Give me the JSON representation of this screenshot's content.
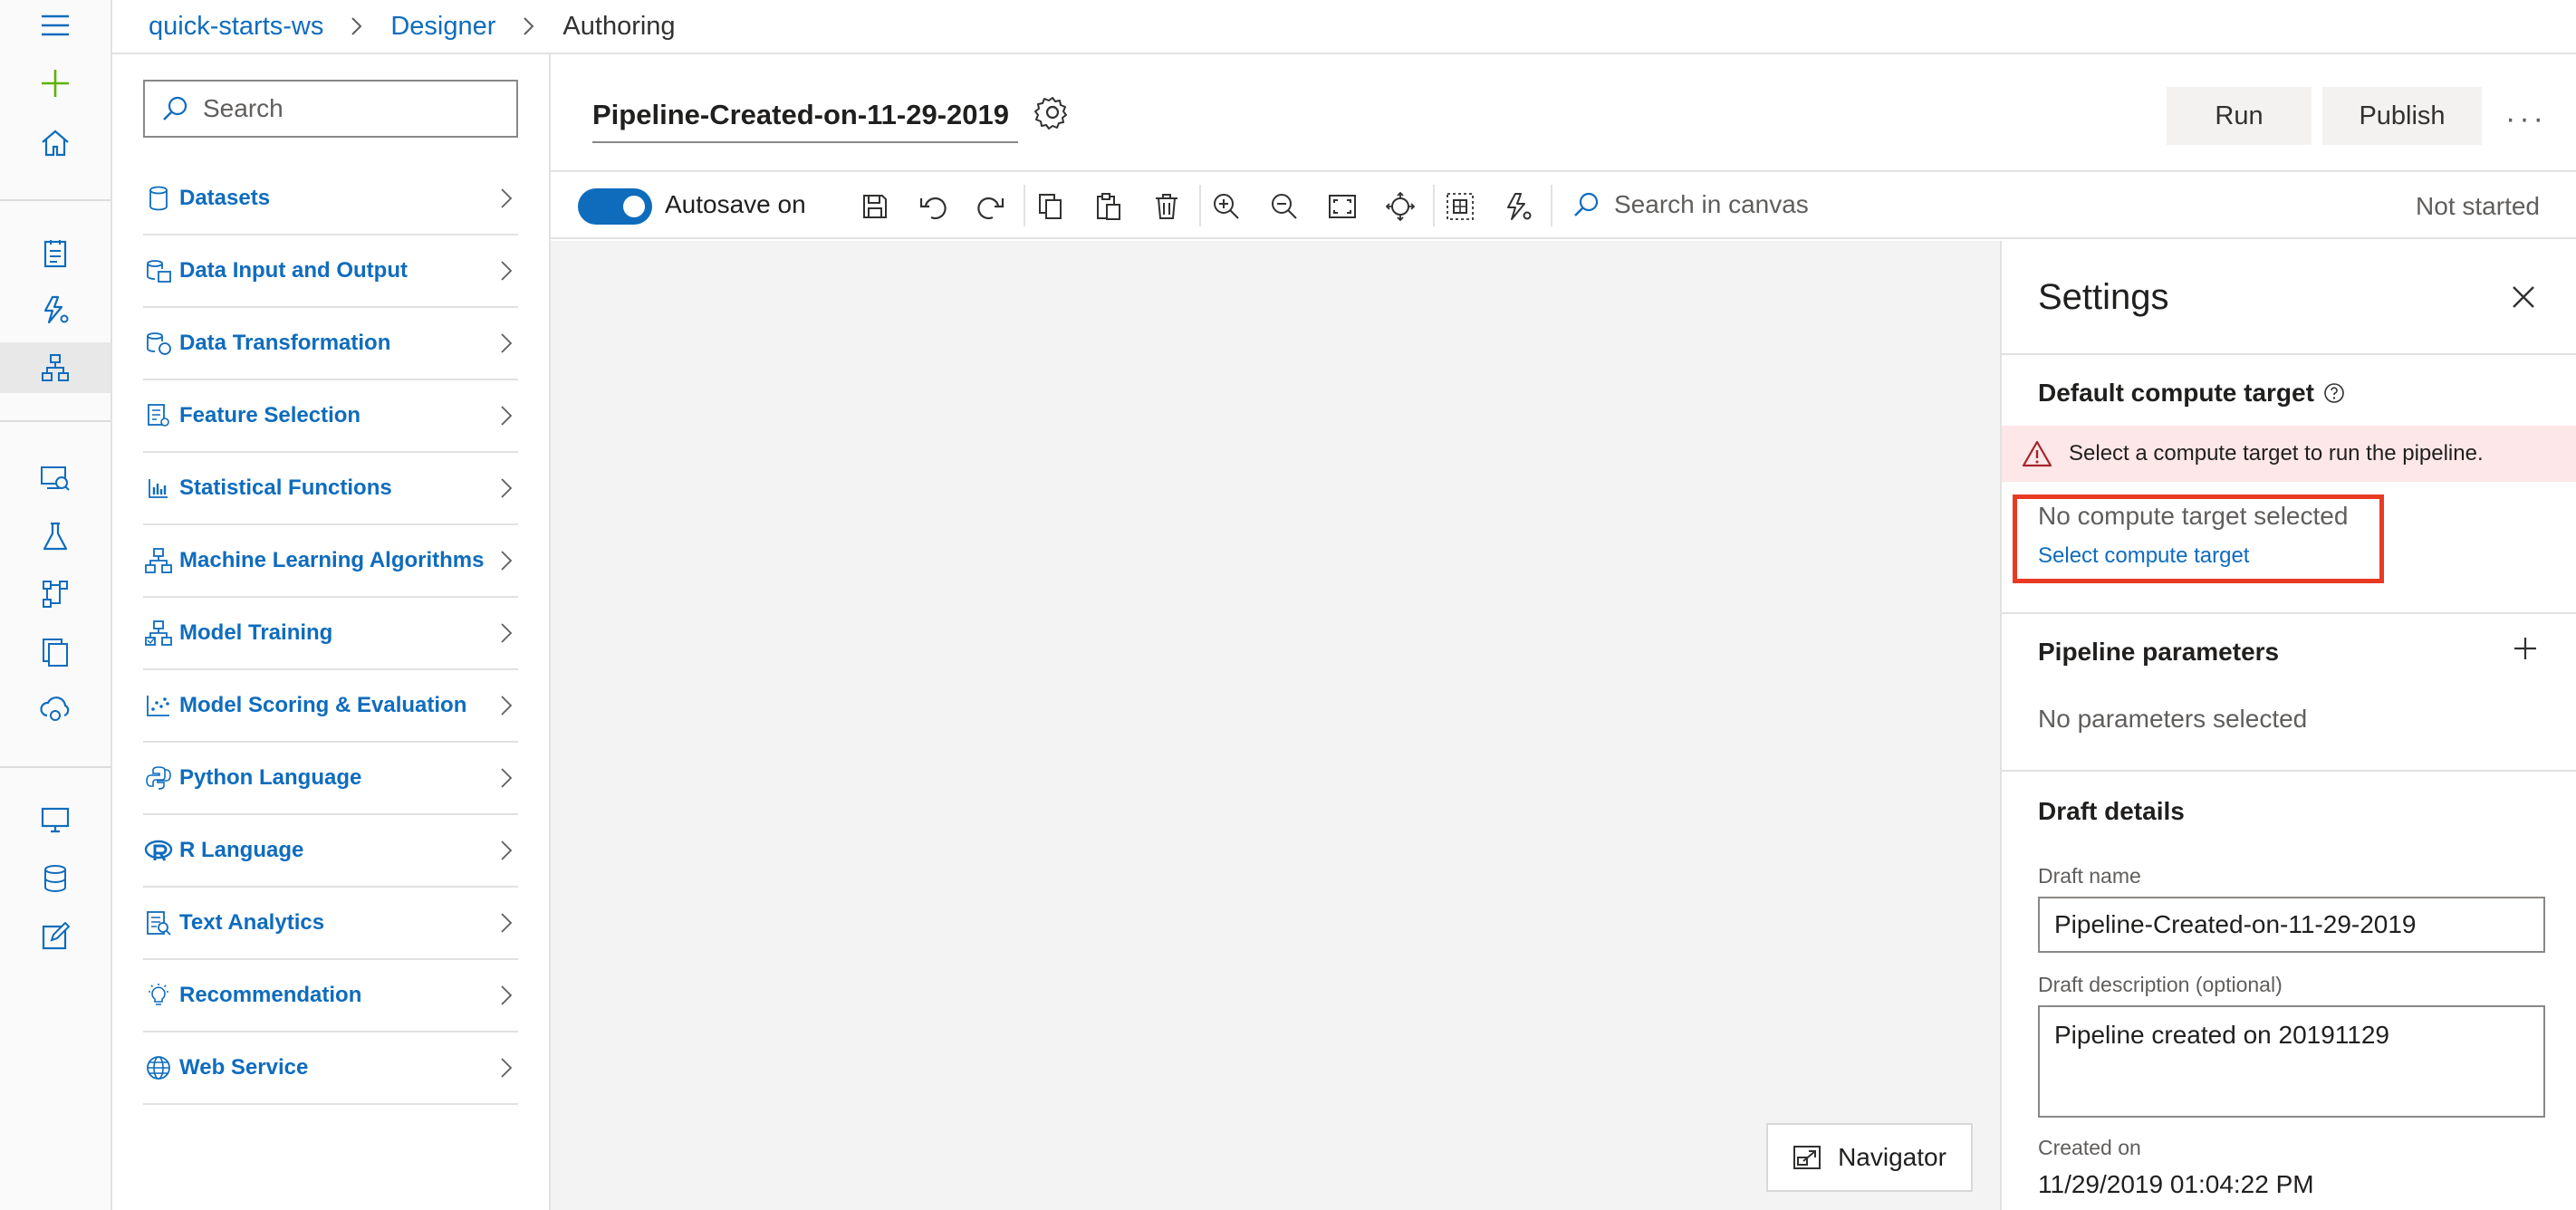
{
  "breadcrumb": {
    "workspace": "quick-starts-ws",
    "designer": "Designer",
    "current": "Authoring"
  },
  "palette": {
    "search_placeholder": "Search",
    "items": [
      {
        "label": "Datasets",
        "icon": "dataset-icon"
      },
      {
        "label": "Data Input and Output",
        "icon": "data-io-icon"
      },
      {
        "label": "Data Transformation",
        "icon": "data-transform-icon"
      },
      {
        "label": "Feature Selection",
        "icon": "feature-selection-icon"
      },
      {
        "label": "Statistical Functions",
        "icon": "bar-chart-icon"
      },
      {
        "label": "Machine Learning Algorithms",
        "icon": "ml-algorithm-icon"
      },
      {
        "label": "Model Training",
        "icon": "model-training-icon"
      },
      {
        "label": "Model Scoring & Evaluation",
        "icon": "scatter-icon"
      },
      {
        "label": "Python Language",
        "icon": "python-icon"
      },
      {
        "label": "R Language",
        "icon": "r-language-icon"
      },
      {
        "label": "Text Analytics",
        "icon": "text-analytics-icon"
      },
      {
        "label": "Recommendation",
        "icon": "lightbulb-icon"
      },
      {
        "label": "Web Service",
        "icon": "globe-icon"
      }
    ]
  },
  "header": {
    "pipeline_name": "Pipeline-Created-on-11-29-2019",
    "run_label": "Run",
    "publish_label": "Publish",
    "more_label": "···"
  },
  "toolbar": {
    "autosave_label": "Autosave on",
    "autosave_on": true,
    "canvas_search_placeholder": "Search in canvas",
    "status": "Not started"
  },
  "canvas": {
    "navigator_label": "Navigator"
  },
  "settings": {
    "title": "Settings",
    "compute_heading": "Default compute target",
    "warning": "Select a compute target to run the pipeline.",
    "no_compute": "No compute target selected",
    "select_compute_link": "Select compute target",
    "params_heading": "Pipeline parameters",
    "no_params": "No parameters selected",
    "draft_heading": "Draft details",
    "draft_name_label": "Draft name",
    "draft_name_value": "Pipeline-Created-on-11-29-2019",
    "draft_desc_label": "Draft description (optional)",
    "draft_desc_value": "Pipeline created on 20191129",
    "created_on_label": "Created on",
    "created_on_value": "11/29/2019 01:04:22 PM"
  },
  "colors": {
    "accent": "#0f6cbd",
    "warning_bg": "#fde7e9",
    "highlight_border": "#e83a22",
    "add_icon": "#5db300"
  }
}
